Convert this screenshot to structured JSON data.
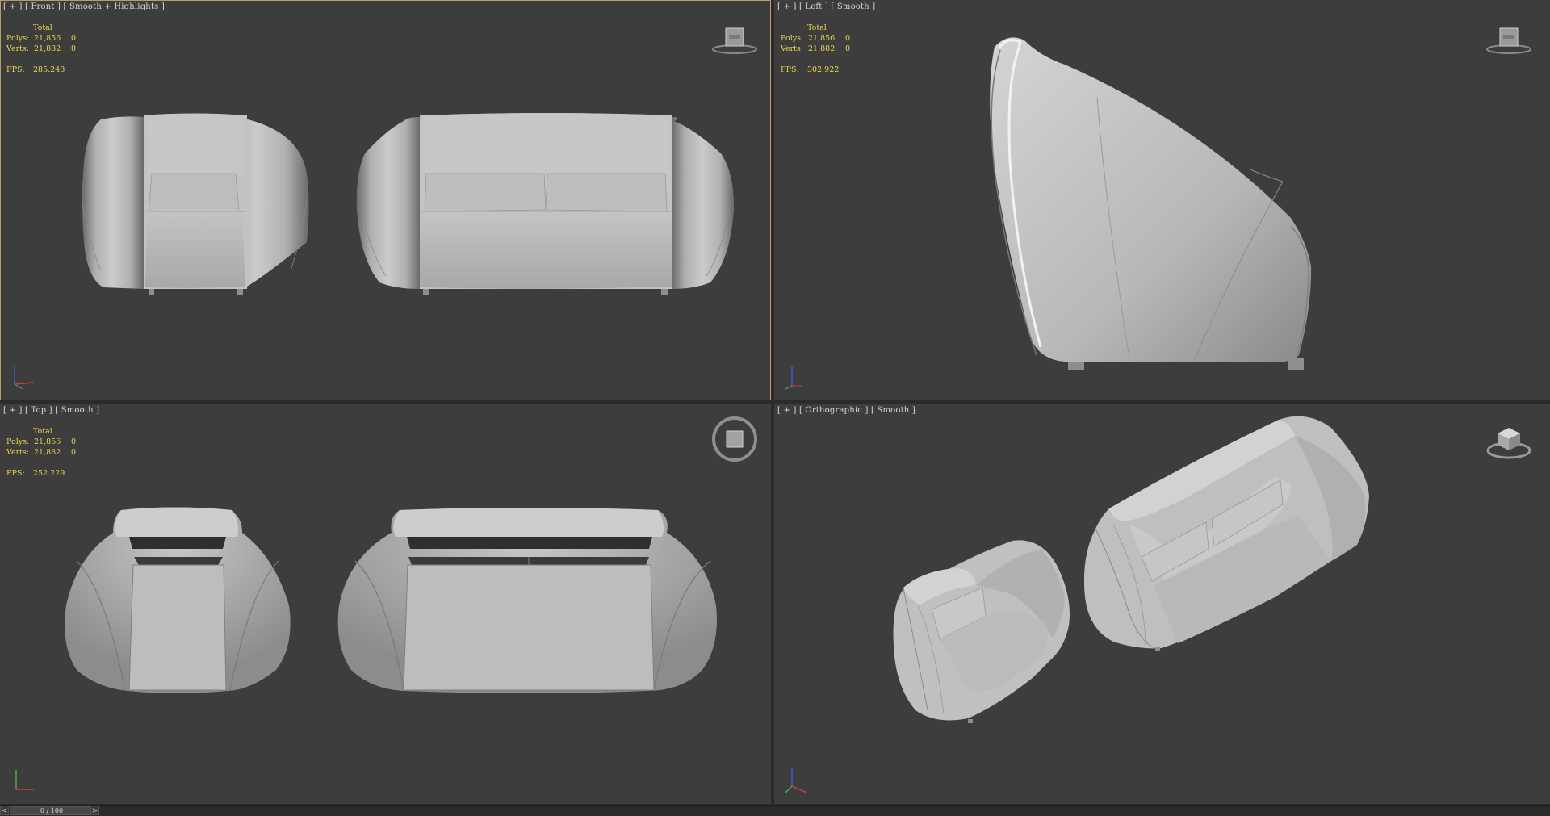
{
  "viewports": {
    "front": {
      "label": [
        "[ + ]",
        "[ Front ]",
        "[ Smooth + Highlights ]"
      ],
      "stats": {
        "total": "Total",
        "polys_label": "Polys:",
        "polys": "21,856",
        "polys_sel": "0",
        "verts_label": "Verts:",
        "verts": "21,882",
        "verts_sel": "0",
        "fps_label": "FPS:",
        "fps": "285.248"
      },
      "viewcube": "FRONT"
    },
    "left": {
      "label": [
        "[ + ]",
        "[ Left ]",
        "[ Smooth ]"
      ],
      "stats": {
        "total": "Total",
        "polys_label": "Polys:",
        "polys": "21,856",
        "polys_sel": "0",
        "verts_label": "Verts:",
        "verts": "21,882",
        "verts_sel": "0",
        "fps_label": "FPS:",
        "fps": "302.922"
      },
      "viewcube": "LEFT"
    },
    "top": {
      "label": [
        "[ + ]",
        "[ Top ]",
        "[ Smooth ]"
      ],
      "stats": {
        "total": "Total",
        "polys_label": "Polys:",
        "polys": "21,856",
        "polys_sel": "0",
        "verts_label": "Verts:",
        "verts": "21,882",
        "verts_sel": "0",
        "fps_label": "FPS:",
        "fps": "252.229"
      },
      "viewcube": "TOP"
    },
    "ortho": {
      "label": [
        "[ + ]",
        "[ Orthographic ]",
        "[ Smooth ]"
      ]
    }
  },
  "timeline": {
    "prev": "<",
    "next": ">",
    "frame": "0 / 100"
  },
  "colors": {
    "viewport_bg": "#3d3d3d",
    "active_border": "#b8a064",
    "stats_text": "#e8d54a",
    "model_light": "#c9c9c9",
    "model_dark": "#6e6e6e"
  },
  "icons": [
    "viewcube-icon",
    "axis-tripod-icon",
    "steering-wheel-icon"
  ]
}
